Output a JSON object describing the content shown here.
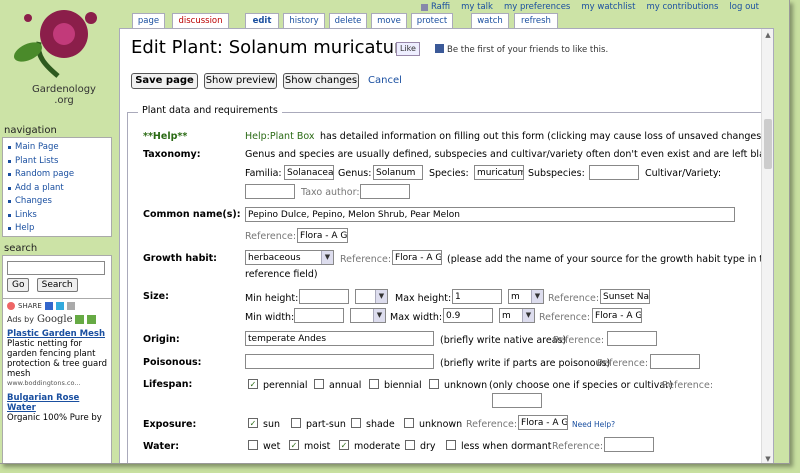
{
  "logo": {
    "text_line1": "Gardenology",
    "text_line2": ".org"
  },
  "user_links": [
    "Raffi",
    "my talk",
    "my preferences",
    "my watchlist",
    "my contributions",
    "log out"
  ],
  "tabs": [
    "page",
    "discussion",
    "edit",
    "history",
    "delete",
    "move",
    "protect",
    "watch",
    "refresh"
  ],
  "navigation": {
    "heading": "navigation",
    "items": [
      "Main Page",
      "Plant Lists",
      "Random page",
      "Add a plant",
      "Changes",
      "Links",
      "Help"
    ]
  },
  "search": {
    "heading": "search",
    "go": "Go",
    "search": "Search"
  },
  "share": {
    "label": "SHARE"
  },
  "ads": {
    "ads_by": "Ads by",
    "google": "Google",
    "ad1_title": "Plastic Garden Mesh",
    "ad1_text": "Plastic netting for garden fencing plant protection & tree guard mesh",
    "ad1_url": "www.boddingtons.co...",
    "ad2_title": "Bulgarian Rose Water",
    "ad2_text": "Organic 100% Pure by"
  },
  "page": {
    "title": "Edit Plant: Solanum muricatum",
    "like_label": "Like",
    "like_text": "Be the first of your friends to like this.",
    "save": "Save page",
    "preview": "Show preview",
    "changes": "Show changes",
    "cancel": "Cancel",
    "legend": "Plant data and requirements"
  },
  "form": {
    "help_label": "**Help**",
    "help_link": "Help:Plant Box",
    "help_text": "has detailed information on filling out this form (clicking may cause loss of unsaved changes)",
    "taxonomy_label": "Taxonomy:",
    "taxonomy_text": "Genus and species are usually defined, subspecies and cultivar/variety often don't even exist and are left blank.",
    "familia": "Familia:",
    "familia_val": "Solanaceae",
    "genus": "Genus:",
    "genus_val": "Solanum",
    "species": "Species:",
    "species_val": "muricatum",
    "subspecies": "Subspecies:",
    "cultivar": "Cultivar/Variety:",
    "taxo_author": "Taxo author:",
    "common_label": "Common name(s):",
    "common_val": "Pepino Dulce, Pepino, Melon Shrub, Pear Melon",
    "reference": "Reference:",
    "ref_flora": "Flora - A G",
    "growth_label": "Growth habit:",
    "growth_val": "herbaceous",
    "growth_note1": "(please add the name of your source for the growth habit type in the",
    "growth_note2": "reference field)",
    "size_label": "Size:",
    "min_height": "Min height:",
    "max_height": "Max height:",
    "max_height_val": "1",
    "unit_m": "m",
    "ref_sunset": "Sunset Na",
    "min_width": "Min width:",
    "max_width": "Max width:",
    "max_width_val": "0.9",
    "origin_label": "Origin:",
    "origin_val": "temperate Andes",
    "origin_note": "(briefly write native areas)",
    "poison_label": "Poisonous:",
    "poison_note": "(briefly write if parts are poisonous)",
    "lifespan_label": "Lifespan:",
    "lifespan_opts": [
      "perennial",
      "annual",
      "biennial",
      "unknown"
    ],
    "lifespan_note": "(only choose one if species or cultivar)",
    "exposure_label": "Exposure:",
    "exposure_opts": [
      "sun",
      "part-sun",
      "shade",
      "unknown"
    ],
    "need_help": "Need Help?",
    "water_label": "Water:",
    "water_opts": [
      "wet",
      "moist",
      "moderate",
      "dry",
      "less when dormant"
    ]
  }
}
